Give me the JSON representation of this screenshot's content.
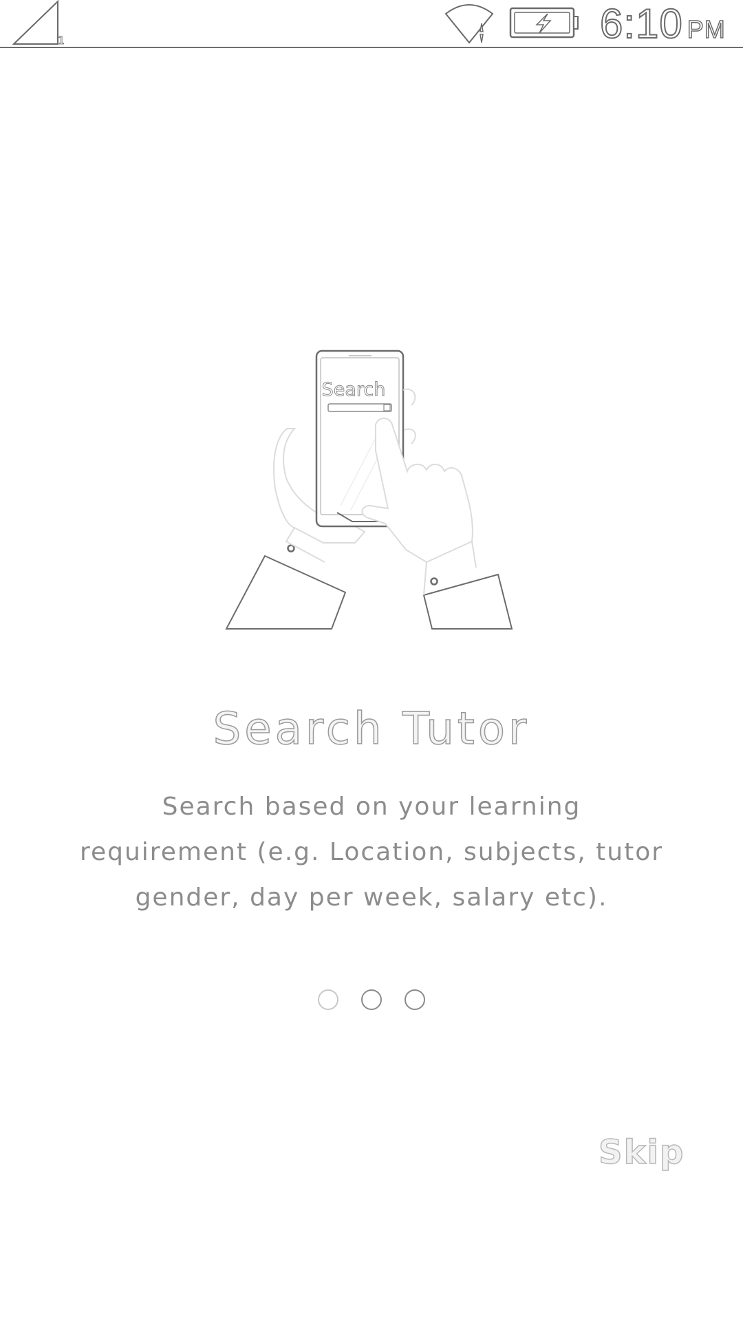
{
  "status_bar": {
    "signal_icon": "cellular-signal-icon",
    "sim_number": "1",
    "wifi_icon": "wifi-icon",
    "battery_icon": "battery-charging-icon",
    "time": "6:10",
    "ampm": "PM"
  },
  "onboarding": {
    "illustration_icon": "hands-holding-phone-icon",
    "illustration_search_text": "Search",
    "title": "Search Tutor",
    "description": "Search based on your learning requirement (e.g. Location, subjects, tutor gender, day per week, salary etc).",
    "page_count": 3,
    "current_page": 1
  },
  "actions": {
    "skip_label": "Skip"
  },
  "colors": {
    "background": "#ffffff",
    "line": "#6e6e6e",
    "text": "#888888"
  }
}
